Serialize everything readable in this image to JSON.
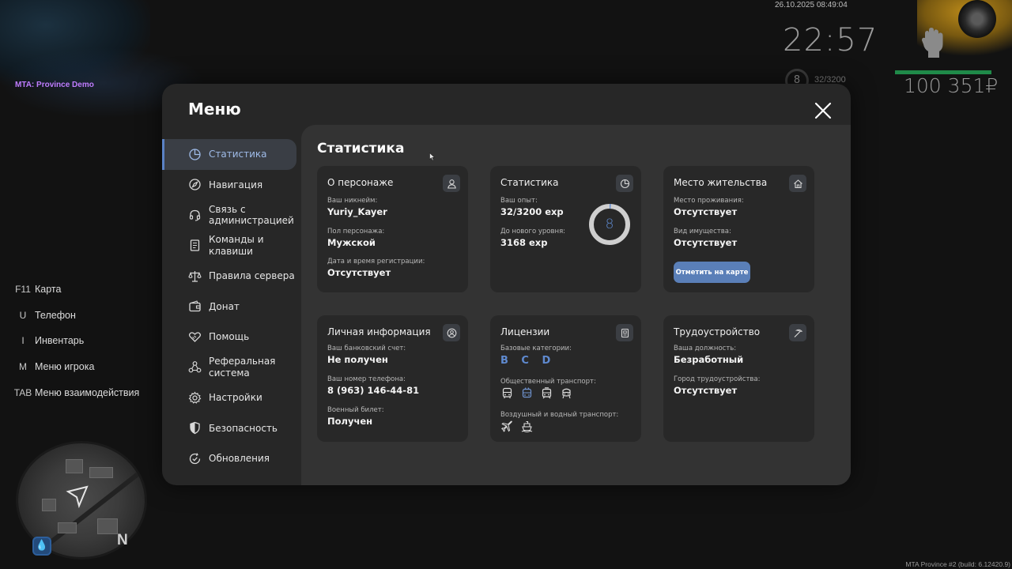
{
  "hud": {
    "datetime": "26.10.2025 08:49:04",
    "clock": "22:57",
    "level": "8",
    "exp": "32/3200",
    "money": "100 351₽",
    "server_label": "MTA: Province Demo",
    "build": "MTA Province #2 (build: 6.12420.9)",
    "north": "N",
    "colors": {
      "money_bar": "#1f8a49",
      "server_label": "#c07cff"
    }
  },
  "hotkeys": [
    {
      "key": "F11",
      "action": "Карта"
    },
    {
      "key": "U",
      "action": "Телефон"
    },
    {
      "key": "I",
      "action": "Инвентарь"
    },
    {
      "key": "M",
      "action": "Меню игрока"
    },
    {
      "key": "TAB",
      "action": "Меню взаимодействия"
    }
  ],
  "menu": {
    "title": "Меню",
    "close_icon": "close-icon",
    "accent": "#5a82c5",
    "nav": [
      {
        "label": "Статистика",
        "icon": "pie-chart-icon",
        "active": true
      },
      {
        "label": "Навигация",
        "icon": "compass-icon",
        "active": false
      },
      {
        "label": "Связь с администрацией",
        "icon": "headset-icon",
        "active": false
      },
      {
        "label": "Команды и клавиши",
        "icon": "document-icon",
        "active": false
      },
      {
        "label": "Правила сервера",
        "icon": "scales-icon",
        "active": false
      },
      {
        "label": "Донат",
        "icon": "wallet-icon",
        "active": false
      },
      {
        "label": "Помощь",
        "icon": "handshake-heart-icon",
        "active": false
      },
      {
        "label": "Реферальная система",
        "icon": "network-icon",
        "active": false
      },
      {
        "label": "Настройки",
        "icon": "gear-icon",
        "active": false
      },
      {
        "label": "Безопасность",
        "icon": "shield-icon",
        "active": false
      },
      {
        "label": "Обновления",
        "icon": "refresh-check-icon",
        "active": false
      }
    ]
  },
  "content": {
    "title": "Статистика",
    "character": {
      "title": "О персонаже",
      "nick_label": "Ваш никнейм:",
      "nick": "Yuriy_Kayer",
      "gender_label": "Пол персонажа:",
      "gender": "Мужской",
      "reg_label": "Дата и время регистрации:",
      "reg": "Отсутствует"
    },
    "stats": {
      "title": "Статистика",
      "exp_label": "Ваш опыт:",
      "exp": "32/3200 exp",
      "next_label": "До нового уровня:",
      "next": "3168 exp",
      "level": "8",
      "progress": 0.01
    },
    "residence": {
      "title": "Место жительства",
      "place_label": "Место проживания:",
      "place": "Отсутствует",
      "property_label": "Вид имущества:",
      "property": "Отсутствует",
      "map_button": "Отметить на карте"
    },
    "personal": {
      "title": "Личная информация",
      "bank_label": "Ваш банковский счет:",
      "bank": "Не получен",
      "phone_label": "Ваш номер телефона:",
      "phone": "8 (963) 146-44-81",
      "military_label": "Военный билет:",
      "military": "Получен"
    },
    "licenses": {
      "title": "Лицензии",
      "base_label": "Базовые категории:",
      "base": "B C D",
      "public_label": "Общественный транспорт:",
      "public_icons": [
        "bus-icon",
        "trolleybus-icon",
        "tram-icon",
        "metro-icon"
      ],
      "air_label": "Воздушный и водный транспорт:",
      "air_icons": [
        "plane-icon",
        "boat-icon"
      ]
    },
    "job": {
      "title": "Трудоустройство",
      "position_label": "Ваша должность:",
      "position": "Безработный",
      "city_label": "Город трудоустройства:",
      "city": "Отсутствует"
    }
  }
}
